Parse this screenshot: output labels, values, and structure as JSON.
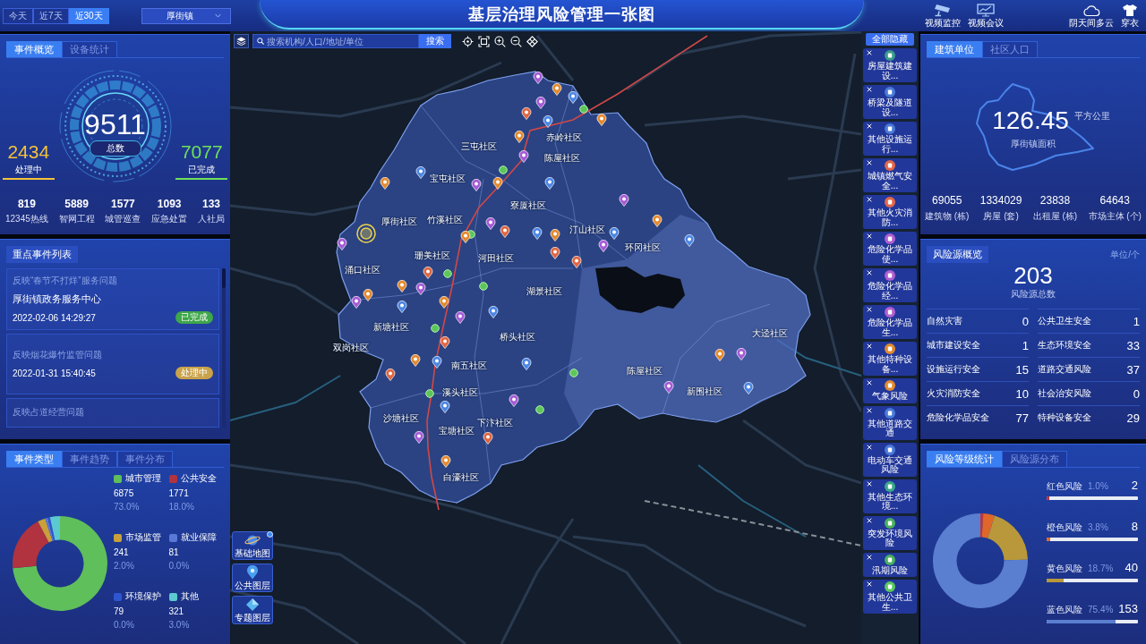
{
  "header": {
    "periods": [
      {
        "label": "今天",
        "selected": false
      },
      {
        "label": "近7天",
        "selected": false
      },
      {
        "label": "近30天",
        "selected": true
      }
    ],
    "town_select": {
      "value": "厚街镇"
    },
    "title": "基层治理风险管理一张图",
    "tools": [
      {
        "kind": "camera",
        "label": "视频监控"
      },
      {
        "kind": "monitor",
        "label": "视频会议"
      },
      {
        "kind": "cloud",
        "label": "阴天间多云"
      },
      {
        "kind": "shirt",
        "label": "穿衣"
      }
    ]
  },
  "event_overview": {
    "tabs": [
      {
        "label": "事件概览",
        "selected": true
      },
      {
        "label": "设备统计",
        "selected": false
      }
    ],
    "total": {
      "value": "9511",
      "label": "总数"
    },
    "processing": {
      "value": "2434",
      "label": "处理中"
    },
    "completed": {
      "value": "7077",
      "label": "已完成"
    },
    "sources": [
      {
        "value": "819",
        "label": "12345热线"
      },
      {
        "value": "5889",
        "label": "智网工程"
      },
      {
        "value": "1577",
        "label": "城管巡查"
      },
      {
        "value": "1093",
        "label": "应急处置"
      },
      {
        "value": "133",
        "label": "人社局"
      }
    ]
  },
  "key_events": {
    "title": "重点事件列表",
    "items": [
      {
        "title": "反映“春节不打烊”服务问题",
        "place": "厚街镇政务服务中心",
        "time": "2022-02-06 14:29:27",
        "status": {
          "label": "已完成",
          "kind": "done"
        }
      },
      {
        "title": "反映烟花爆竹监管问题",
        "time": "2022-01-31 15:40:45",
        "status": {
          "label": "处理中",
          "kind": "processing"
        }
      },
      {
        "title": "反映占道经营问题"
      }
    ]
  },
  "event_types": {
    "tabs": [
      {
        "label": "事件类型",
        "selected": true
      },
      {
        "label": "事件趋势",
        "selected": false
      },
      {
        "label": "事件分布",
        "selected": false
      }
    ],
    "chart_data": {
      "type": "donut",
      "categories": [
        "城市管理",
        "公共安全",
        "市场监管",
        "就业保障",
        "环境保护",
        "其他"
      ],
      "values": [
        73.4,
        18.9,
        2.6,
        0.9,
        0.8,
        3.4
      ]
    },
    "legend": [
      {
        "value": "6875",
        "percent": "73.0%",
        "color": "#5fbf5a"
      },
      {
        "value": "1771",
        "percent": "18.0%",
        "color": "#b0333f"
      },
      {
        "value": "241",
        "percent": "2.0%",
        "color": "#c9a03a"
      },
      {
        "value": "81",
        "percent": "0.0%",
        "color": "#5a78d8"
      },
      {
        "value": "79",
        "percent": "0.0%",
        "color": "#2f55d0"
      },
      {
        "value": "321",
        "percent": "3.0%",
        "color": "#5cc9d0"
      }
    ]
  },
  "map": {
    "search": {
      "placeholder": "搜索机构/人口/地址/单位"
    },
    "search_button": "搜索",
    "communities": [
      "三屯社区",
      "赤岭社区",
      "陈屋社区",
      "宝屯社区",
      "寮厦社区",
      "厚街社区",
      "竹溪社区",
      "汀山社区",
      "环冈社区",
      "珊美社区",
      "河田社区",
      "涌口社区",
      "湖景社区",
      "新塘社区",
      "桥头社区",
      "双岗社区",
      "大迳社区",
      "南五社区",
      "陈屋社区",
      "新围社区",
      "溪头社区",
      "沙塘社区",
      "下汴社区",
      "宝塘社区",
      "白濠社区"
    ],
    "layers": [
      {
        "kind": "planet",
        "label": "基础地图",
        "notified": true
      },
      {
        "kind": "pin",
        "label": "公共图层",
        "notified": false
      },
      {
        "kind": "diamond",
        "label": "专题图层",
        "notified": false
      }
    ]
  },
  "map_legend": {
    "hide_all": "全部隐藏",
    "items": [
      {
        "label": "房屋建筑建设...",
        "color": "#3a9a8a"
      },
      {
        "label": "桥梁及隧道设...",
        "color": "#4a7ad8"
      },
      {
        "label": "其他设施运行...",
        "color": "#4a7ad8"
      },
      {
        "label": "城镇燃气安全...",
        "color": "#e0674a"
      },
      {
        "label": "其他火灾消防...",
        "color": "#e0674a"
      },
      {
        "label": "危险化学品使...",
        "color": "#b060d0"
      },
      {
        "label": "危险化学品经...",
        "color": "#b060d0"
      },
      {
        "label": "危险化学品生...",
        "color": "#b060d0"
      },
      {
        "label": "其他特种设备...",
        "color": "#e08a30"
      },
      {
        "label": "气象风险",
        "color": "#e08a30"
      },
      {
        "label": "其他道路交通",
        "color": "#4a7ad8"
      },
      {
        "label": "电动车交通风险",
        "color": "#4a7ad8"
      },
      {
        "label": "其他生态环境...",
        "color": "#3aa88a"
      },
      {
        "label": "突发环境风险",
        "color": "#4ab060"
      },
      {
        "label": "汛期风险",
        "color": "#4ab060"
      },
      {
        "label": "其他公共卫生...",
        "color": "#5ac860"
      }
    ]
  },
  "area": {
    "tabs": [
      {
        "label": "建筑单位",
        "selected": true
      },
      {
        "label": "社区人口",
        "selected": false
      }
    ],
    "value": "126.45",
    "unit": "平方公里",
    "caption": "厚街镇面积",
    "stats": [
      {
        "value": "69055",
        "label": "建筑物 (栋)"
      },
      {
        "value": "1334029",
        "label": "房屋 (套)"
      },
      {
        "value": "23838",
        "label": "出租屋 (栋)"
      },
      {
        "value": "64643",
        "label": "市场主体 (个)"
      }
    ]
  },
  "risk_overview": {
    "title": "风险源概览",
    "unit": "单位/个",
    "total": "203",
    "total_label": "风险源总数",
    "items": [
      {
        "name": "自然灾害",
        "value": "0"
      },
      {
        "name": "公共卫生安全",
        "value": "1"
      },
      {
        "name": "城市建设安全",
        "value": "1"
      },
      {
        "name": "生态环境安全",
        "value": "33"
      },
      {
        "name": "设施运行安全",
        "value": "15"
      },
      {
        "name": "道路交通风险",
        "value": "37"
      },
      {
        "name": "火灾消防安全",
        "value": "10"
      },
      {
        "name": "社会治安风险",
        "value": "0"
      },
      {
        "name": "危险化学品安全",
        "value": "77"
      },
      {
        "name": "特种设备安全",
        "value": "29"
      }
    ]
  },
  "risk_levels": {
    "tabs": [
      {
        "label": "风险等级统计",
        "selected": true
      },
      {
        "label": "风险源分布",
        "selected": false
      }
    ],
    "chart_data": {
      "type": "donut",
      "categories": [
        "红色风险",
        "橙色风险",
        "黄色风险",
        "蓝色风险"
      ],
      "values": [
        1.0,
        3.9,
        19.7,
        75.4
      ]
    },
    "levels": [
      {
        "percent": "1.0%",
        "count": "2",
        "level": 0.01,
        "color": "#c0343c"
      },
      {
        "percent": "3.8%",
        "count": "8",
        "level": 0.038,
        "color": "#e0672a"
      },
      {
        "percent": "18.7%",
        "count": "40",
        "level": 0.187,
        "color": "#b8983a"
      },
      {
        "percent": "75.4%",
        "count": "153",
        "level": 0.754,
        "color": "#5a7ed0"
      }
    ]
  }
}
